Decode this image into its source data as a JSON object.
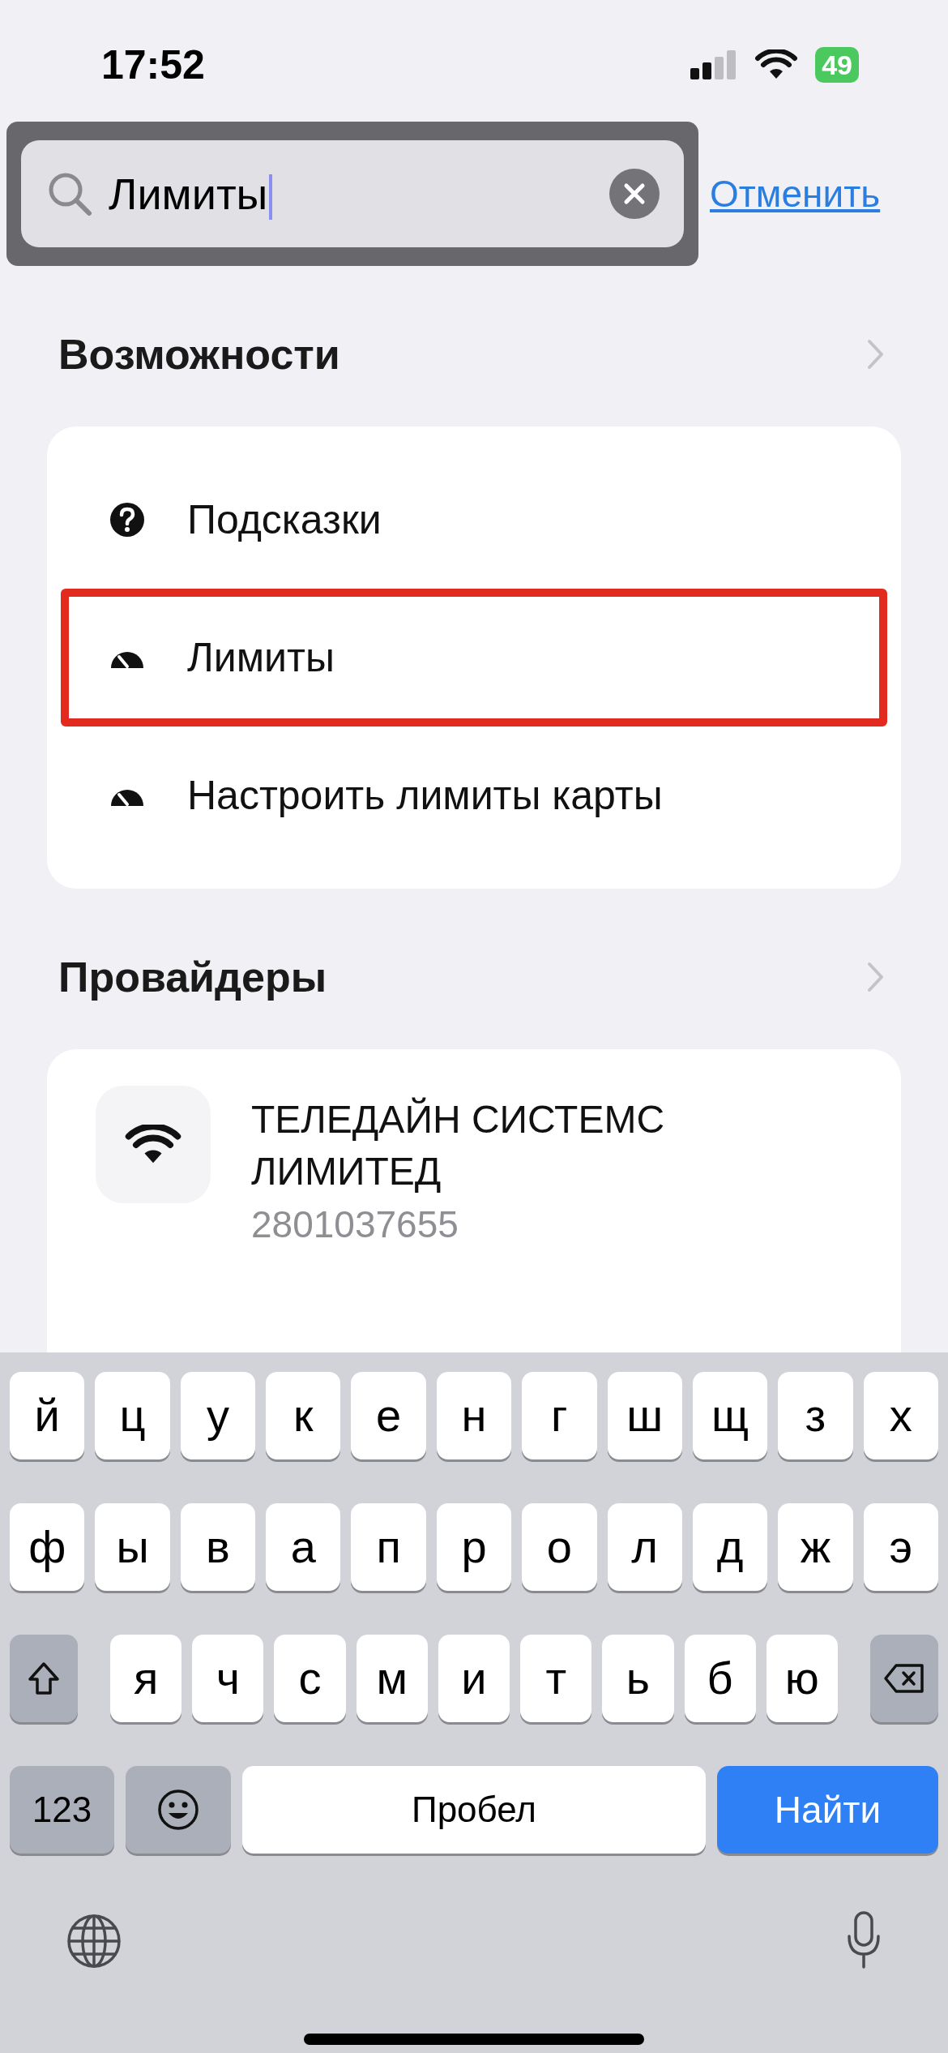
{
  "status_bar": {
    "time": "17:52",
    "battery": "49"
  },
  "search": {
    "value": "Лимиты",
    "cancel": "Отменить",
    "highlighted": true
  },
  "sections": [
    {
      "title": "Возможности",
      "items": [
        {
          "label": "Подсказки",
          "kind": "help",
          "highlighted": false
        },
        {
          "label": "Лимиты",
          "kind": "gauge",
          "highlighted": true
        },
        {
          "label": "Настроить лимиты карты",
          "kind": "gauge",
          "highlighted": false
        }
      ]
    },
    {
      "title": "Провайдеры",
      "providers": [
        {
          "name": "ТЕЛЕДАЙН СИСТЕМС ЛИМИТЕД",
          "subtitle": "2801037655"
        }
      ]
    }
  ],
  "keyboard": {
    "top_row": [
      "й",
      "ц",
      "у",
      "к",
      "е",
      "н",
      "г",
      "ш",
      "щ",
      "з",
      "х"
    ],
    "middle_row": [
      "ф",
      "ы",
      "в",
      "а",
      "п",
      "р",
      "о",
      "л",
      "д",
      "ж",
      "э"
    ],
    "bottom_row": [
      "я",
      "ч",
      "с",
      "м",
      "и",
      "т",
      "ь",
      "б",
      "ю"
    ],
    "numbers": "123",
    "space": "Пробел",
    "action": "Найти"
  }
}
